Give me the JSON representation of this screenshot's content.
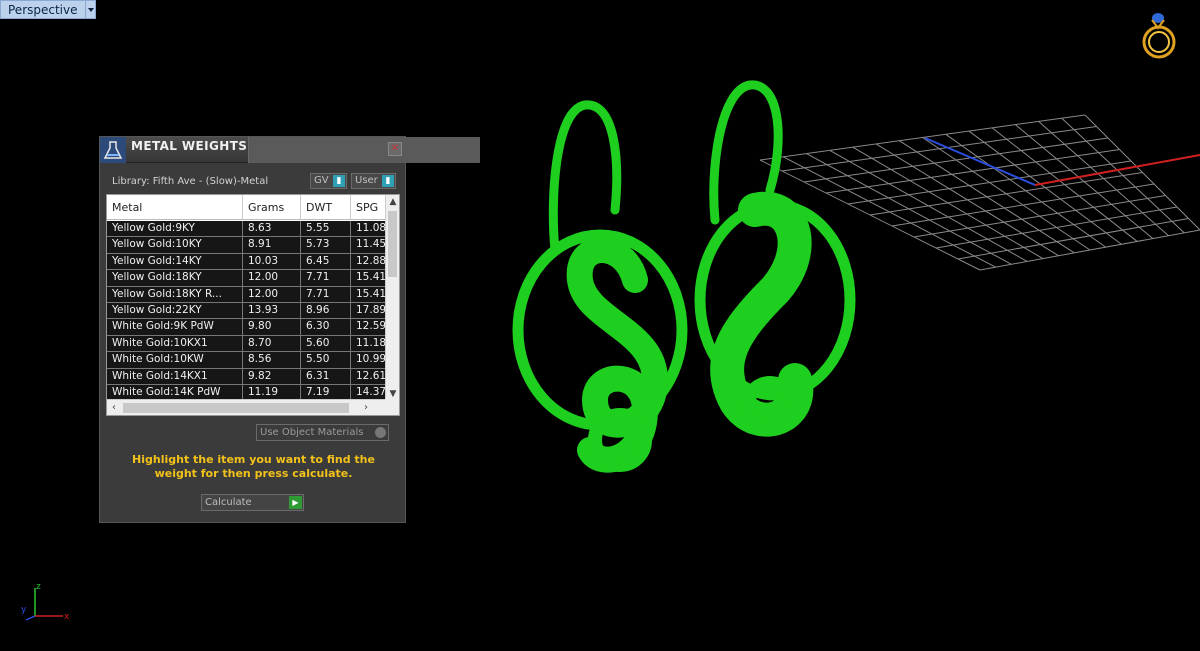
{
  "viewport": {
    "label": "Perspective"
  },
  "panel": {
    "title": "METAL WEIGHTS",
    "library_label": "Library: Fifth Ave - (Slow)-Metal",
    "gv_label": "GV",
    "user_label": "User",
    "columns": [
      "Metal",
      "Grams",
      "DWT",
      "SPG"
    ],
    "rows": [
      [
        "Yellow Gold:9KY",
        "8.63",
        "5.55",
        "11.08"
      ],
      [
        "Yellow Gold:10KY",
        "8.91",
        "5.73",
        "11.45"
      ],
      [
        "Yellow Gold:14KY",
        "10.03",
        "6.45",
        "12.88"
      ],
      [
        "Yellow Gold:18KY",
        "12.00",
        "7.71",
        "15.41"
      ],
      [
        "Yellow Gold:18KY R...",
        "12.00",
        "7.71",
        "15.41"
      ],
      [
        "Yellow Gold:22KY",
        "13.93",
        "8.96",
        "17.89"
      ],
      [
        "White Gold:9K PdW",
        "9.80",
        "6.30",
        "12.59"
      ],
      [
        "White Gold:10KX1",
        "8.70",
        "5.60",
        "11.18"
      ],
      [
        "White Gold:10KW",
        "8.56",
        "5.50",
        "10.99"
      ],
      [
        "White Gold:14KX1",
        "9.82",
        "6.31",
        "12.61"
      ],
      [
        "White Gold:14K PdW",
        "11.19",
        "7.19",
        "14.37"
      ]
    ],
    "use_object_materials": "Use Object Materials",
    "hint": "Highlight the item you want to find the weight for then press calculate.",
    "calculate_label": "Calculate"
  },
  "axis": {
    "x": "x",
    "y": "y",
    "z": "z"
  },
  "colors": {
    "model": "#1fcf1f",
    "panel_bg": "#3b3b3b",
    "hint": "#f2c21a",
    "grid": "#8a8a8a"
  }
}
